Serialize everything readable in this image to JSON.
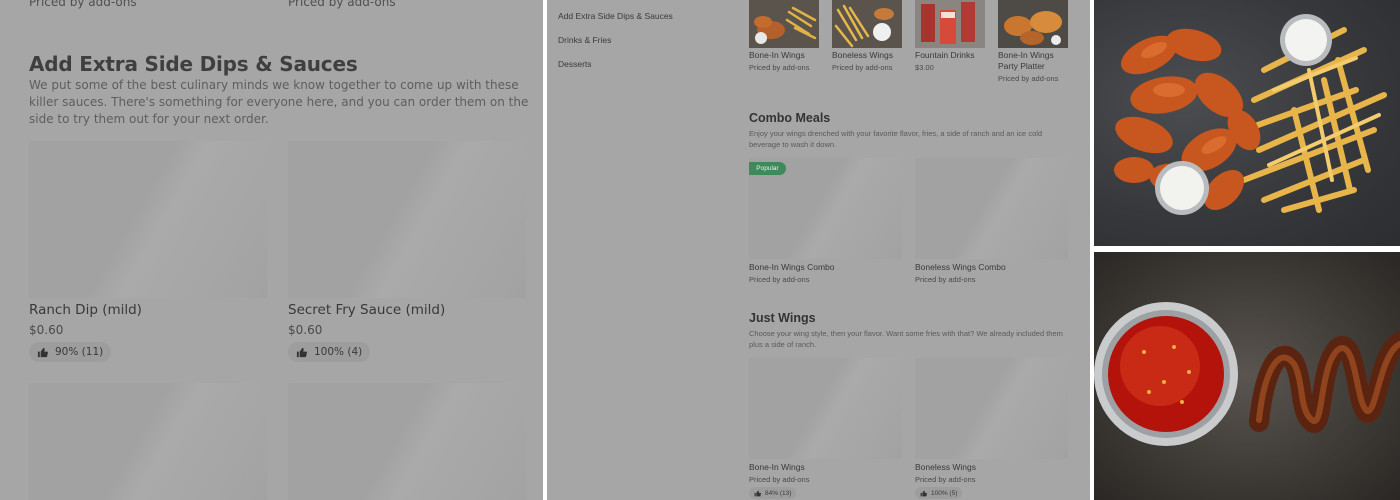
{
  "panel1": {
    "top_items": [
      {
        "sub": "Priced by add-ons"
      },
      {
        "sub": "Priced by add-ons"
      }
    ],
    "section_title": "Add Extra Side Dips & Sauces",
    "section_desc": "We put some of the best culinary minds we know together to come up with these killer sauces. There's something for everyone here, and you can order them on the side to try them out for your next order.",
    "items": [
      {
        "name": "Ranch Dip (mild)",
        "price": "$0.60",
        "rating": "90% (11)"
      },
      {
        "name": "Secret Fry Sauce (mild)",
        "price": "$0.60",
        "rating": "100% (4)"
      }
    ]
  },
  "panel2": {
    "nav": [
      "Add Extra Side Dips & Sauces",
      "Drinks & Fries",
      "Desserts"
    ],
    "top_items": [
      {
        "name": "Bone-In Wings",
        "sub": "Priced by add-ons"
      },
      {
        "name": "Boneless Wings",
        "sub": "Priced by add-ons"
      },
      {
        "name": "Fountain Drinks",
        "sub": "$3.00"
      },
      {
        "name": "Bone-In Wings Party Platter",
        "sub": "Priced by add-ons"
      }
    ],
    "combo": {
      "title": "Combo Meals",
      "desc": "Enjoy your wings drenched with your favorite flavor, fries, a side of ranch and an ice cold beverage to wash it down.",
      "badge": "Popular",
      "items": [
        {
          "name": "Bone-In Wings Combo",
          "sub": "Priced by add-ons"
        },
        {
          "name": "Boneless Wings Combo",
          "sub": "Priced by add-ons"
        }
      ]
    },
    "wings": {
      "title": "Just Wings",
      "desc": "Choose your wing style, then your flavor. Want some fries with that? We already included them plus a side of ranch.",
      "items": [
        {
          "name": "Bone-In Wings",
          "sub": "Priced by add-ons",
          "rating": "84% (13)"
        },
        {
          "name": "Boneless Wings",
          "sub": "Priced by add-ons",
          "rating": "100% (5)"
        }
      ]
    }
  },
  "icons": {
    "rating": "thumbs-up-icon"
  },
  "colors": {
    "overlay": "#a6a6a6",
    "popular_badge": "#3f8a5a"
  }
}
